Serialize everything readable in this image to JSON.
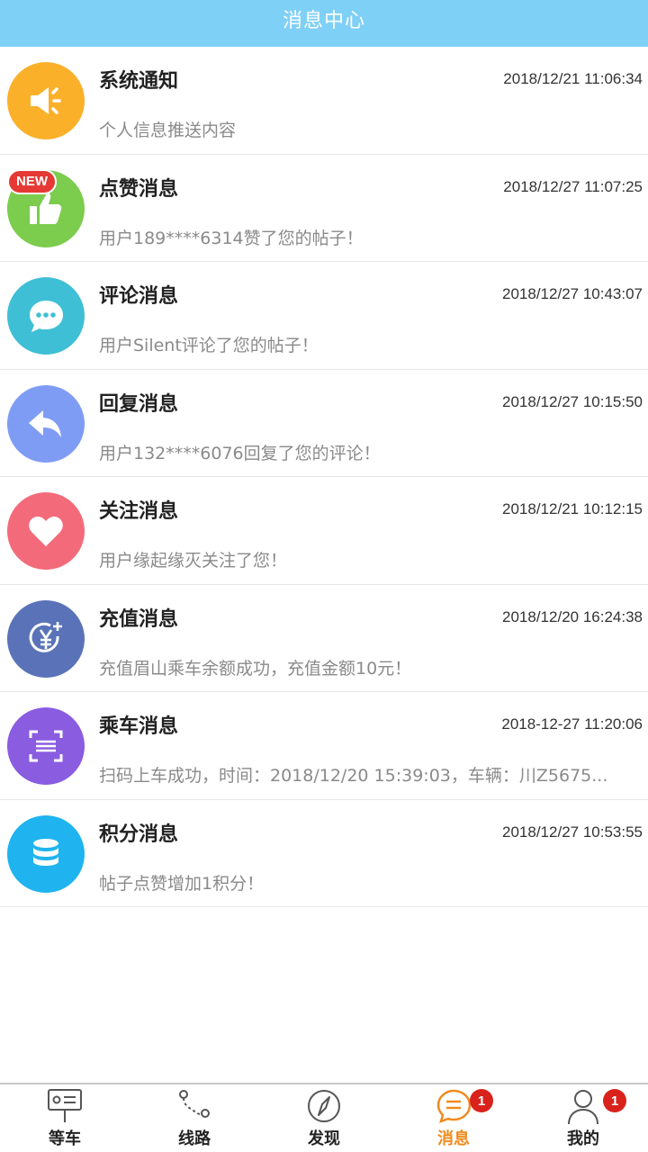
{
  "header": {
    "title": "消息中心"
  },
  "messages": [
    {
      "title": "系统通知",
      "time": "2018/12/21 11:06:34",
      "desc": "个人信息推送内容",
      "icon": "speaker-icon",
      "color": "#fbb02a"
    },
    {
      "title": "点赞消息",
      "time": "2018/12/27 11:07:25",
      "desc": "用户189****6314赞了您的帖子！",
      "icon": "thumbs-up-icon",
      "color": "#7ccc4d",
      "badge": "NEW"
    },
    {
      "title": "评论消息",
      "time": "2018/12/27 10:43:07",
      "desc": "用户Silent评论了您的帖子！",
      "icon": "chat-bubble-icon",
      "color": "#3fbfd6"
    },
    {
      "title": "回复消息",
      "time": "2018/12/27 10:15:50",
      "desc": "用户132****6076回复了您的评论！",
      "icon": "reply-arrow-icon",
      "color": "#7f9cf5"
    },
    {
      "title": "关注消息",
      "time": "2018/12/21 10:12:15",
      "desc": "用户缘起缘灭关注了您！",
      "icon": "heart-icon",
      "color": "#f36b7a"
    },
    {
      "title": "充值消息",
      "time": "2018/12/20 16:24:38",
      "desc": "充值眉山乘车余额成功，充值金额10元！",
      "icon": "yen-coin-icon",
      "color": "#5a73b8"
    },
    {
      "title": "乘车消息",
      "time": "2018-12-27 11:20:06",
      "desc": "扫码上车成功，时间：2018/12/20 15:39:03，车辆：川Z5675...",
      "icon": "scan-frame-icon",
      "color": "#8a5ce0"
    },
    {
      "title": "积分消息",
      "time": "2018/12/27 10:53:55",
      "desc": "帖子点赞增加1积分！",
      "icon": "coin-stack-icon",
      "color": "#1fb4ef"
    }
  ],
  "tabs": [
    {
      "label": "等车",
      "icon": "bus-stop-icon"
    },
    {
      "label": "线路",
      "icon": "route-icon"
    },
    {
      "label": "发现",
      "icon": "compass-icon"
    },
    {
      "label": "消息",
      "icon": "message-icon",
      "active": true,
      "badge": "1"
    },
    {
      "label": "我的",
      "icon": "user-icon",
      "badge": "1"
    }
  ],
  "colors": {
    "header": "#7fd0f6",
    "active_tab": "#f08a1c",
    "badge": "#d9221c"
  }
}
